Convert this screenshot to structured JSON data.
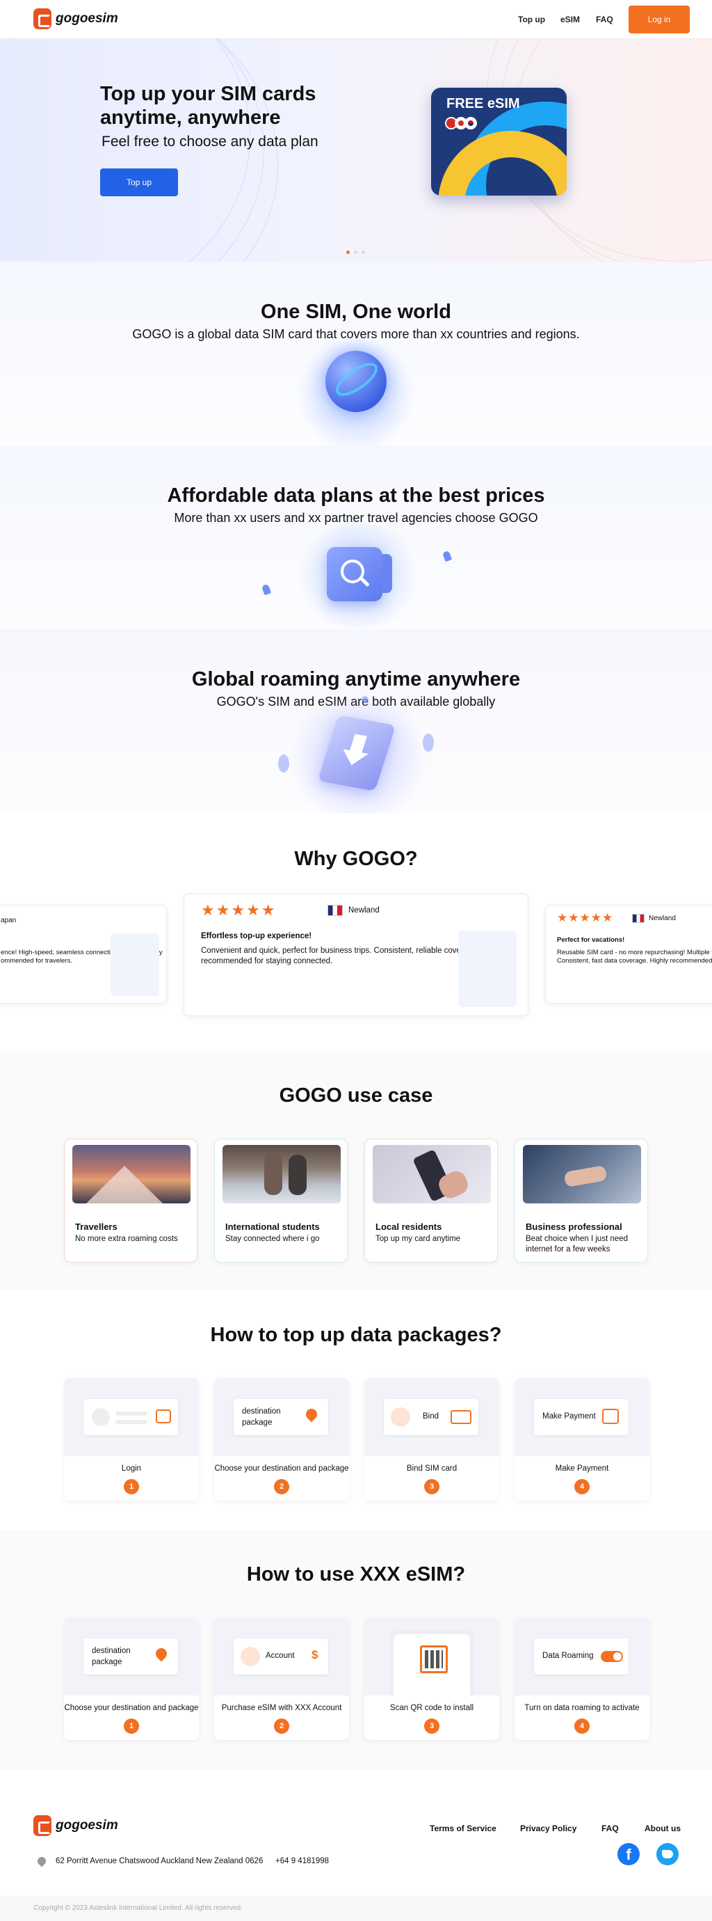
{
  "header": {
    "logo_text": "gogoesim",
    "nav": [
      "Top up",
      "eSIM",
      "FAQ"
    ],
    "login_label": "Log in"
  },
  "hero": {
    "title": "Top up your SIM cards anytime, anywhere",
    "subtitle": "Feel free to choose any data plan",
    "button": "Top up",
    "card_text": "FREE eSIM",
    "carousel_pages": 3,
    "carousel_active": 1
  },
  "sections": [
    {
      "title": "One SIM, One world",
      "subtitle": "GOGO is a global data SIM card that covers more than xx  countries and regions."
    },
    {
      "title": "Affordable data plans at the best prices",
      "subtitle": "More than xx users and xx partner travel agencies choose GOGO"
    },
    {
      "title": "Global roaming anytime anywhere",
      "subtitle": "GOGO's SIM and eSIM are both available globally"
    }
  ],
  "why": {
    "title": "Why GOGO?",
    "left": {
      "country": "apan",
      "text": "ence! High-speed, seamless connectivity; effortless city",
      "text2": "ommended for travelers."
    },
    "center": {
      "rating": 5,
      "country": "Newland",
      "title": "Effortless top-up experience!",
      "text": "Convenient and quick, perfect for business trips. Consistent, reliable coverage. Highly recommended for staying connected."
    },
    "right": {
      "rating": 5,
      "country": "Newland",
      "title": "Perfect for vacations!",
      "text": "Reusable SIM card - no more repurchasing! Multiple top",
      "text2": "Consistent, fast data coverage. Highly recommended fo"
    }
  },
  "cases": {
    "title": "GOGO use case",
    "items": [
      {
        "name": "Travellers",
        "desc": "No more extra roaming costs"
      },
      {
        "name": "International students",
        "desc": "Stay connected where i go"
      },
      {
        "name": "Local residents",
        "desc": "Top up my card anytime"
      },
      {
        "name": "Business professional",
        "desc": "Beat choice when I just need internet for a few weeks"
      }
    ]
  },
  "topup": {
    "title": "How to top up data packages?",
    "steps": [
      {
        "label": "Login",
        "num": "1",
        "box": ""
      },
      {
        "label": "Choose your destination and package",
        "num": "2",
        "box": "destination package"
      },
      {
        "label": "Bind SIM card",
        "num": "3",
        "box": "Bind"
      },
      {
        "label": "Make Payment",
        "num": "4",
        "box": "Make Payment"
      }
    ]
  },
  "esim": {
    "title": "How to use XXX eSIM?",
    "steps": [
      {
        "label": "Choose your destination and package",
        "num": "1",
        "box": "destination package"
      },
      {
        "label": "Purchase eSIM with XXX Account",
        "num": "2",
        "box": "Account"
      },
      {
        "label": "Scan QR code to install",
        "num": "3",
        "box": ""
      },
      {
        "label": "Turn on data roaming to activate",
        "num": "4",
        "box": "Data Roaming"
      }
    ]
  },
  "footer": {
    "logo_text": "gogoesim",
    "links": [
      "Terms of Service",
      "Privacy Policy",
      "FAQ",
      "About us"
    ],
    "address": "62 Porritt Avenue Chatswood Auckland New Zealand 0626",
    "phone": "+64 9 4181998",
    "copyright": "Copyright © 2023 Asteslink International Limited. All rights reserved."
  },
  "colors": {
    "accent": "#f37021",
    "primary": "#2262e6",
    "card_blue": "#1e3a7a",
    "card_yellow": "#f7c532",
    "facebook": "#1877f2",
    "twitter": "#1da1f2"
  }
}
